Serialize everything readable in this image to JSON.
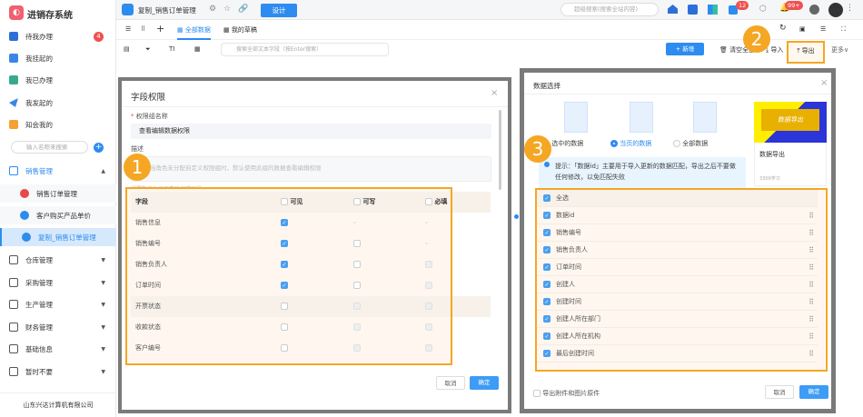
{
  "app": {
    "name": "进销存系统"
  },
  "sidebar": {
    "items": [
      {
        "label": "待我办理",
        "badge": "4"
      },
      {
        "label": "我挂起的"
      },
      {
        "label": "我已办理"
      },
      {
        "label": "我发起的"
      },
      {
        "label": "知会我的"
      }
    ],
    "search_placeholder": "输入名称来搜索",
    "groups": [
      {
        "label": "销售管理"
      },
      {
        "label": "仓库管理"
      },
      {
        "label": "采购管理"
      },
      {
        "label": "生产管理"
      },
      {
        "label": "财务管理"
      },
      {
        "label": "基础信息"
      },
      {
        "label": "暂时不要"
      }
    ],
    "sub_items": [
      {
        "label": "销售订单管理"
      },
      {
        "label": "客户购买产品单价"
      },
      {
        "label": "复制_销售订单管理"
      }
    ],
    "footer": "山东兴达计算机有限公司"
  },
  "topbar": {
    "page_title": "复制_销售订单管理",
    "design_label": "设计",
    "search_placeholder": "超级搜索(搜索全站内容)",
    "task_badge": "12",
    "notif_badge": "99+"
  },
  "tabs": [
    {
      "label": "全部数据"
    },
    {
      "label": "我的草稿"
    }
  ],
  "toolbar": {
    "search_placeholder": "搜索全部文本字段（按Enter搜索）",
    "new_label": "+ 新增",
    "clear_label": "清空全部",
    "import_label": "导入",
    "export_label": "导出",
    "more_label": "更多"
  },
  "field_modal": {
    "title": "字段权限",
    "name_label": "权限组名称",
    "name_value": "查看编辑数据权限",
    "desc_label": "描述",
    "desc_placeholder": "当角色未分配自定义权限组时，默认使用此组的数据查看编辑权限",
    "hint": "设置数据允许查看的编辑字段",
    "columns": [
      "字段",
      "可见",
      "可写",
      "必填"
    ],
    "rows": [
      {
        "field": "销售信息",
        "visible": true,
        "writable": "-",
        "required": "-"
      },
      {
        "field": "销售编号",
        "visible": true,
        "writable": "off",
        "required": "-"
      },
      {
        "field": "销售负责人",
        "visible": true,
        "writable": "off",
        "required": "dis"
      },
      {
        "field": "订单时间",
        "visible": true,
        "writable": "off",
        "required": "dis"
      },
      {
        "field": "开票状态",
        "visible": false,
        "writable": "dis",
        "required": "dis"
      },
      {
        "field": "收款状态",
        "visible": false,
        "writable": "dis",
        "required": "dis"
      },
      {
        "field": "客户编号",
        "visible": false,
        "writable": "dis",
        "required": "dis"
      }
    ],
    "cancel": "取消",
    "ok": "确定"
  },
  "export_modal": {
    "title": "数据选择",
    "options": [
      {
        "label": "选中的数据",
        "selected": false
      },
      {
        "label": "当页的数据",
        "selected": true
      },
      {
        "label": "全部数据",
        "selected": false
      }
    ],
    "video": {
      "thumb_text": "数据导出",
      "title": "数据导出",
      "views": "3309学习"
    },
    "tip": "提示：「数据id」主要用于导入更新的数据匹配，导出之后不要做任何修改，以免匹配失败",
    "select_all": "全选",
    "fields": [
      "数据id",
      "销售编号",
      "销售负责人",
      "订单时间",
      "创建人",
      "创建时间",
      "创建人所在部门",
      "创建人所在机构",
      "最后创建时间"
    ],
    "attach_label": "导出附件和图片原件",
    "cancel": "取消",
    "ok": "确定"
  },
  "annotations": [
    "1",
    "2",
    "3"
  ],
  "colors": {
    "accent": "#2d8cf0",
    "annotation": "#f5a623"
  }
}
